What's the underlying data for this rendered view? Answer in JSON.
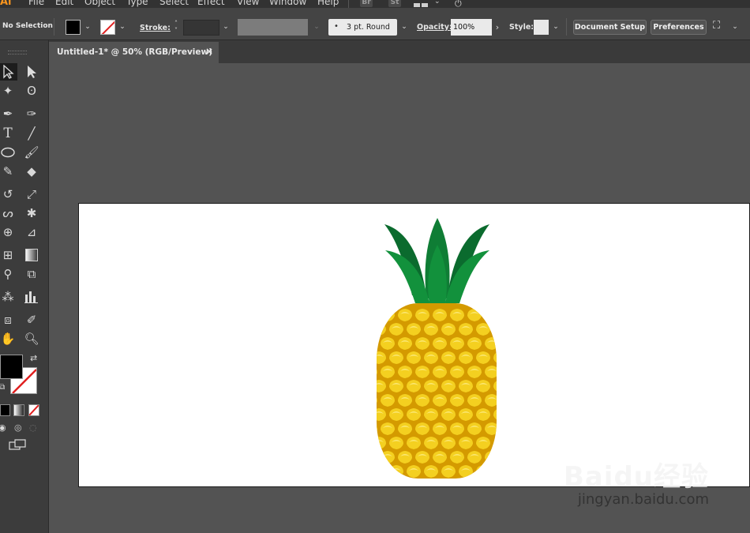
{
  "app": {
    "logo": "Ai"
  },
  "menu": {
    "items": [
      "File",
      "Edit",
      "Object",
      "Type",
      "Select",
      "Effect",
      "View",
      "Window",
      "Help"
    ],
    "bridge": "Br",
    "stock": "St"
  },
  "control": {
    "selection": "No Selection",
    "fill_color": "#000000",
    "stroke_label": "Stroke:",
    "stroke_value": "",
    "brush": "3 pt. Round",
    "opacity_label": "Opacity:",
    "opacity_value": "100%",
    "style_label": "Style:",
    "document_setup": "Document Setup",
    "preferences": "Preferences"
  },
  "tab": {
    "title": "Untitled-1* @ 50% (RGB/Preview)",
    "close": "×"
  },
  "tools": [
    "selection",
    "direct-selection",
    "magic-wand",
    "lasso",
    "pen",
    "curvature",
    "type",
    "line-segment",
    "ellipse",
    "paintbrush",
    "shaper",
    "eraser",
    "rotate",
    "scale",
    "warp",
    "puppet-warp",
    "shape-builder",
    "perspective-grid",
    "mesh",
    "gradient",
    "eyedropper",
    "blend",
    "symbol-sprayer",
    "column-graph",
    "artboard",
    "slice",
    "hand",
    "zoom"
  ],
  "colors": {
    "fill": "#000000",
    "stroke": "#ffffff",
    "accent": "#f7941e",
    "leaf_dark": "#0b6b2e",
    "leaf_light": "#12913c",
    "fruit_base": "#d49a00",
    "fruit_scale": "#f4d020"
  },
  "watermark": {
    "brand": "Baidu经验",
    "url": "jingyan.baidu.com"
  }
}
